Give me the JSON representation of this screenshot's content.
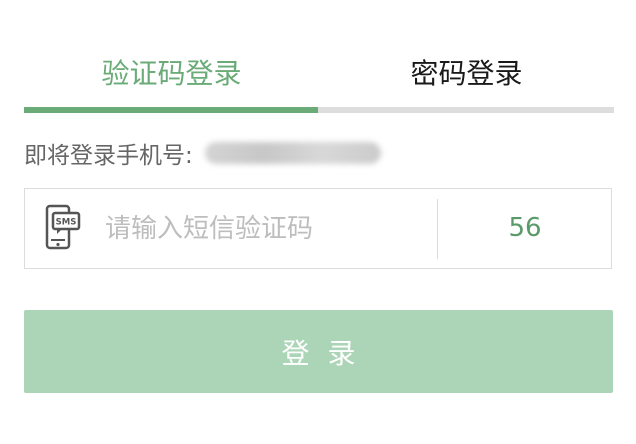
{
  "tabs": [
    {
      "label": "验证码登录",
      "active": true
    },
    {
      "label": "密码登录",
      "active": false
    }
  ],
  "phone": {
    "label": "即将登录手机号:"
  },
  "code_field": {
    "icon": "sms-phone-icon",
    "placeholder": "请输入短信验证码",
    "value": "",
    "countdown": "56"
  },
  "login_button": {
    "label": "登录"
  },
  "colors": {
    "accent": "#6aab78",
    "button_bg": "#abd5b6",
    "tab_track": "#dddddd",
    "countdown": "#5a9a69"
  }
}
